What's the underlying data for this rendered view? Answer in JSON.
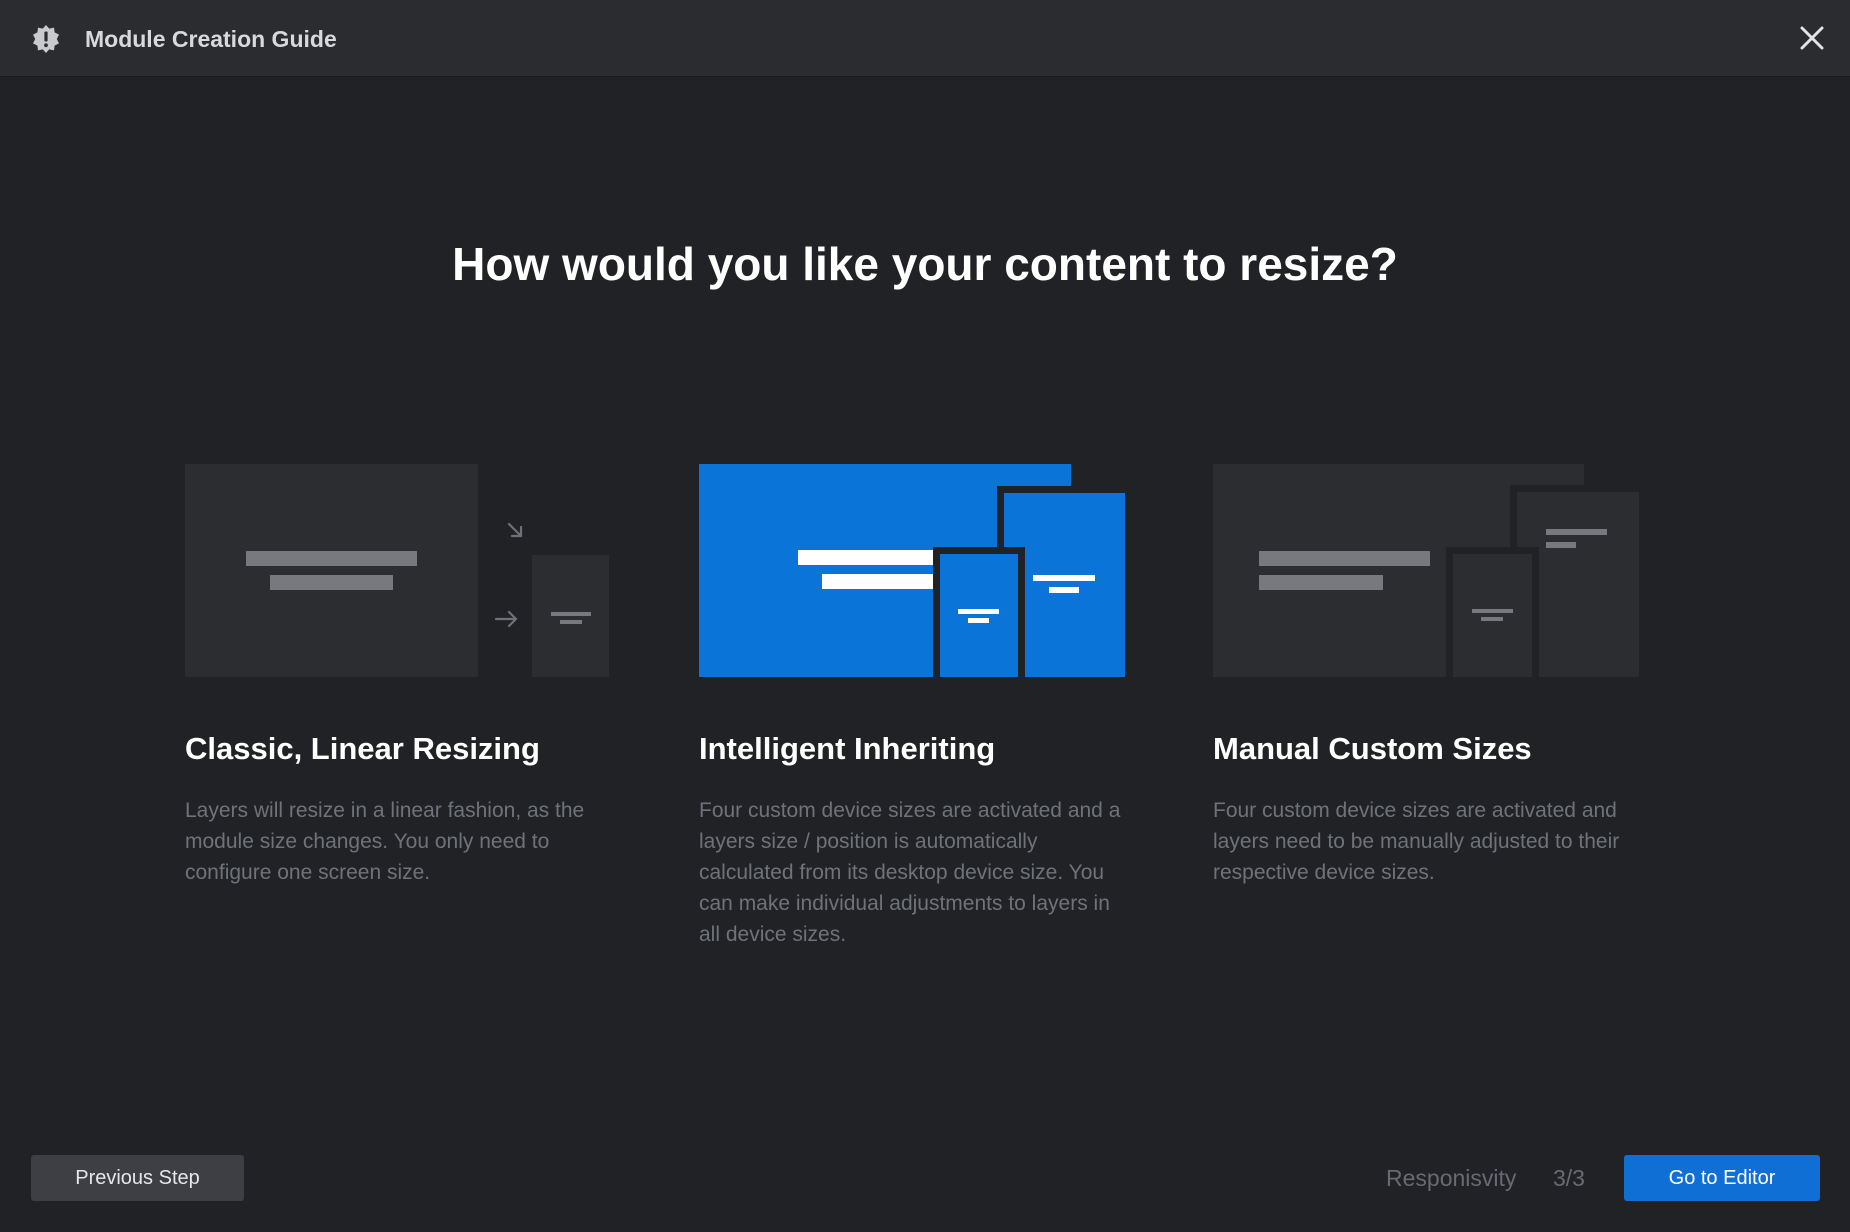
{
  "window": {
    "title": "Module Creation Guide",
    "icon": "gear-badge-icon",
    "close_icon": "close-icon"
  },
  "main": {
    "heading": "How would you like your content to resize?",
    "options": [
      {
        "title": "Classic, Linear Resizing",
        "description": "Layers will resize in a linear fashion, as the module size changes. You only need to configure one screen size.",
        "selected": false
      },
      {
        "title": "Intelligent Inheriting",
        "description": "Four custom device sizes are activated and a layers size / position is automatically calculated from its desktop device size. You can make individual adjustments to layers in all device sizes.",
        "selected": true
      },
      {
        "title": "Manual Custom Sizes",
        "description": "Four custom device sizes are activated and layers need to be manually adjusted to their respective device sizes.",
        "selected": false
      }
    ]
  },
  "footer": {
    "previous_label": "Previous Step",
    "step_label": "Responisvity",
    "step_counter": "3/3",
    "editor_label": "Go to Editor"
  },
  "colors": {
    "background": "#212226",
    "titlebar": "#2b2c30",
    "accent": "#0f6fd4",
    "card_bg": "#2c2d31",
    "placeholder_bar": "#77797e"
  }
}
